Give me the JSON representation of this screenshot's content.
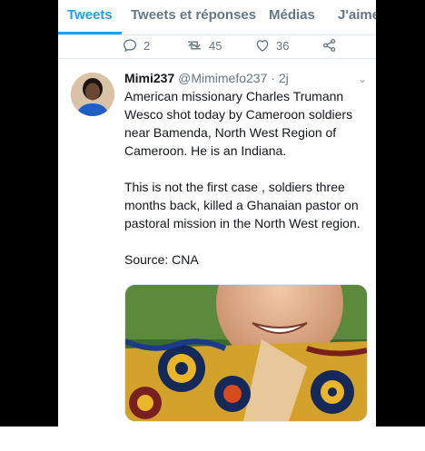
{
  "tabs": [
    {
      "label": "Tweets"
    },
    {
      "label": "Tweets et réponses"
    },
    {
      "label": "Médias"
    },
    {
      "label": "J'aime"
    }
  ],
  "previous_tweet_actions": {
    "reply_count": "2",
    "retweet_count": "45",
    "like_count": "36"
  },
  "tweet": {
    "display_name": "Mimi237",
    "handle": "@Mimimefo237",
    "time": "· 2j",
    "paragraphs": [
      "American missionary Charles Trumann Wesco shot today by Cameroon soldiers near Bamenda, North West Region of Cameroon. He is an Indiana.",
      "This is not the first case , soldiers three months back,  killed a Ghanaian pastor on pastoral mission in the North West region.",
      "Source: CNA"
    ]
  },
  "colors": {
    "accent": "#1da1f2",
    "text": "#14171a",
    "muted": "#657786"
  }
}
